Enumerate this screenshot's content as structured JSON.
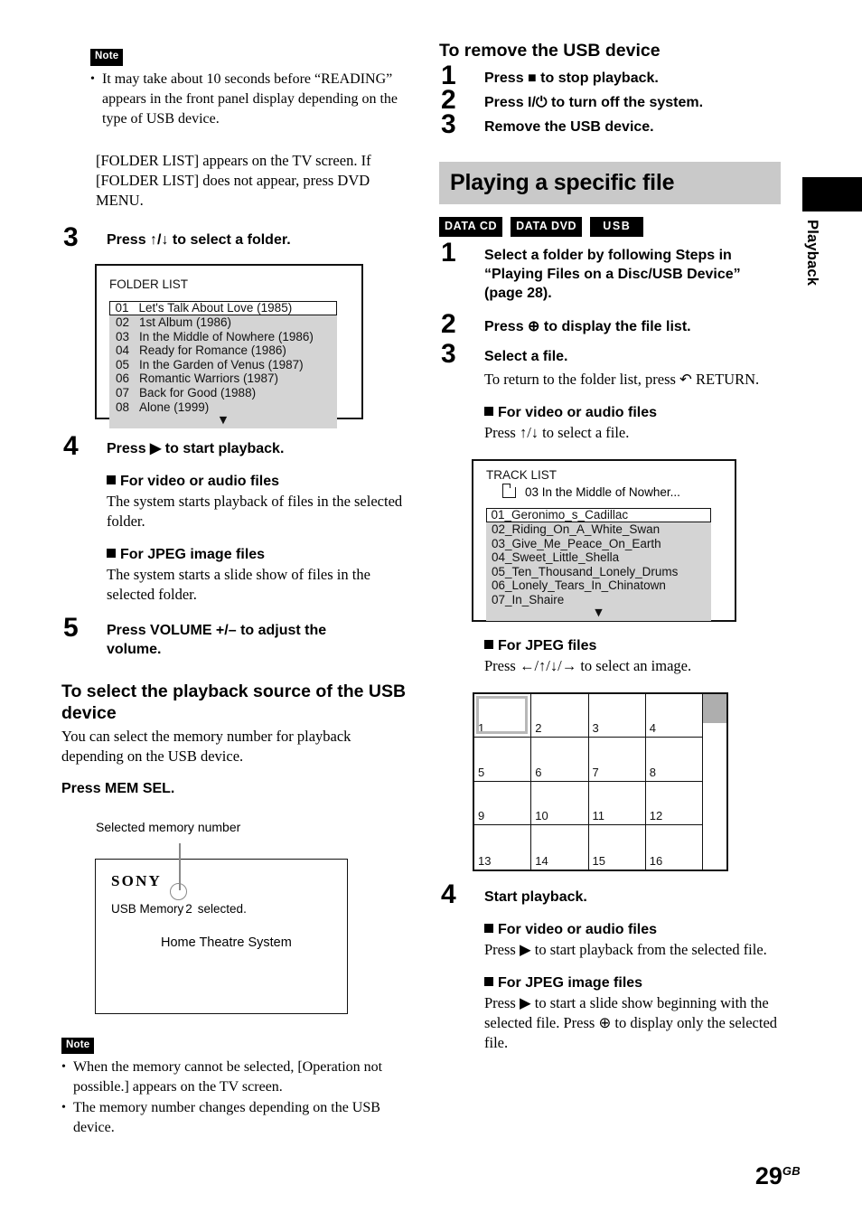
{
  "page": {
    "number": "29",
    "suffix": "GB"
  },
  "tab": {
    "label": "Playback"
  },
  "left_column": {
    "note1": {
      "tag": "Note",
      "items": [
        "It may take about 10 seconds before “READING” appears in the front panel display depending on the type of USB device."
      ]
    },
    "intro_paragraph": "[FOLDER LIST] appears on the TV screen. If [FOLDER LIST] does not appear, press DVD MENU.",
    "step3": {
      "num": "3",
      "title": "Press ↑/↓ to select a folder."
    },
    "folder_list": {
      "title": "FOLDER LIST",
      "rows": [
        {
          "num": "01",
          "name": "Let's Talk About Love (1985)",
          "selected": true
        },
        {
          "num": "02",
          "name": "1st Album (1986)",
          "selected": false
        },
        {
          "num": "03",
          "name": "In the Middle of Nowhere (1986)",
          "selected": false
        },
        {
          "num": "04",
          "name": "Ready for Romance (1986)",
          "selected": false
        },
        {
          "num": "05",
          "name": "In the Garden of Venus (1987)",
          "selected": false
        },
        {
          "num": "06",
          "name": "Romantic Warriors (1987)",
          "selected": false
        },
        {
          "num": "07",
          "name": "Back for Good (1988)",
          "selected": false
        },
        {
          "num": "08",
          "name": "Alone (1999)",
          "selected": false
        }
      ],
      "more_caret": "▼"
    },
    "step4": {
      "num": "4",
      "title": "Press ▶ to start playback.",
      "sub1_head": "For video or audio files",
      "sub1_body": "The system starts playback of files in the selected folder.",
      "sub2_head": "For JPEG image files",
      "sub2_body": "The system starts a slide show of files in the selected folder."
    },
    "step5": {
      "num": "5",
      "title": "Press VOLUME +/– to adjust the volume."
    },
    "section_source": {
      "heading": "To select the playback source of the USB device",
      "body": "You can select the memory number for playback depending on the USB device.",
      "instruction": "Press MEM SEL."
    },
    "callout_caption": "Selected memory number",
    "sony_display": {
      "logo": "SONY",
      "line1_before": "USB Memory",
      "line1_number": "2",
      "line1_after": "selected.",
      "line2": "Home Theatre System"
    },
    "note2": {
      "tag": "Note",
      "items": [
        "When the memory cannot be selected, [Operation not possible.] appears on the TV screen.",
        "The memory number changes depending on the USB device."
      ]
    }
  },
  "right_column": {
    "section_remove": {
      "heading": "To remove the USB device",
      "steps": [
        {
          "num": "1",
          "title": "Press ■ to stop playback."
        },
        {
          "num": "2",
          "title": "Press I/⏻ to turn off the system."
        },
        {
          "num": "3",
          "title": "Remove the USB device."
        }
      ]
    },
    "banner": {
      "title": "Playing a specific file"
    },
    "badges": [
      "DATA CD",
      "DATA DVD",
      "USB"
    ],
    "step1": {
      "num": "1",
      "title": "Select a folder by following Steps in “Playing Files on a Disc/USB Device” (page 28)."
    },
    "step2": {
      "num": "2",
      "title": "Press ⊕ to display the file list."
    },
    "step3": {
      "num": "3",
      "title": "Select a file.",
      "body": "To return to the folder list, press ↶ RETURN.",
      "sub1_head": "For video or audio files",
      "sub1_body": "Press ↑/↓ to select a file."
    },
    "track_list": {
      "title": "TRACK LIST",
      "folder_line": "03  In the Middle of Nowher...",
      "rows": [
        {
          "name": "01_Geronimo_s_Cadillac",
          "selected": true
        },
        {
          "name": "02_Riding_On_A_White_Swan",
          "selected": false
        },
        {
          "name": "03_Give_Me_Peace_On_Earth",
          "selected": false
        },
        {
          "name": "04_Sweet_Little_Shella",
          "selected": false
        },
        {
          "name": "05_Ten_Thousand_Lonely_Drums",
          "selected": false
        },
        {
          "name": "06_Lonely_Tears_In_Chinatown",
          "selected": false
        },
        {
          "name": "07_In_Shaire",
          "selected": false
        }
      ],
      "more_caret": "▼"
    },
    "jpeg_section": {
      "head": "For JPEG files",
      "body": "Press ←/↑/↓/→ to select an image.",
      "thumbnails": [
        "1",
        "2",
        "3",
        "4",
        "5",
        "6",
        "7",
        "8",
        "9",
        "10",
        "11",
        "12",
        "13",
        "14",
        "15",
        "16"
      ],
      "selected_thumbnail": "1"
    },
    "step4": {
      "num": "4",
      "title": "Start playback.",
      "sub1_head": "For video or audio files",
      "sub1_body": "Press ▶ to start playback from the selected file.",
      "sub2_head": "For JPEG image files",
      "sub2_body": "Press ▶ to start a slide show beginning with the selected file. Press ⊕ to display only the selected file."
    }
  }
}
